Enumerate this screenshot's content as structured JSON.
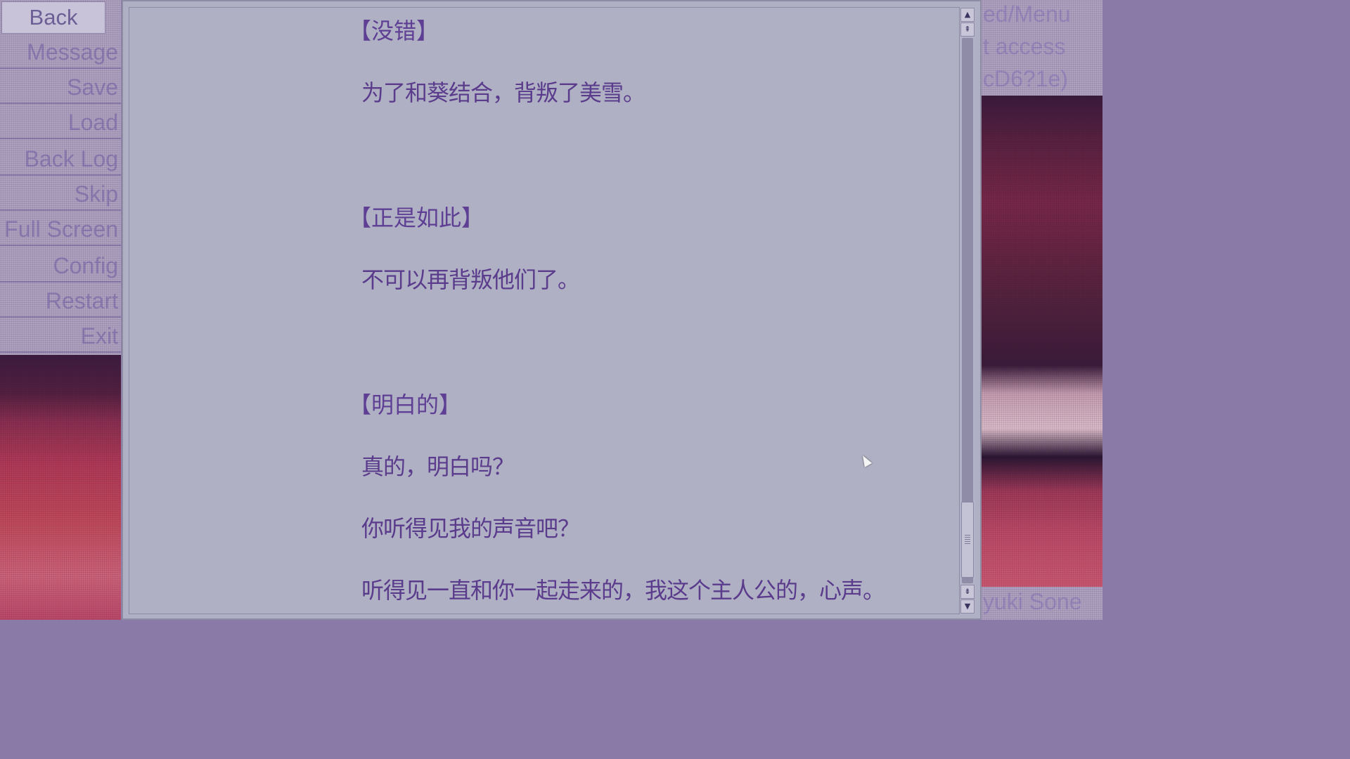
{
  "menu": {
    "back_label": "Back",
    "items": [
      "Message",
      "Save",
      "Load",
      "Back Log",
      "Skip",
      "Full Screen",
      "Config",
      "Restart",
      "Exit"
    ]
  },
  "right_panel": {
    "text_lines": [
      "ed/Menu",
      "t access",
      "cD6?1e)"
    ],
    "bottom_text": "yuki Sone"
  },
  "backlog": {
    "entries": [
      {
        "speaker": "【没错】",
        "lines": [
          "为了和葵结合，背叛了美雪。"
        ]
      },
      {
        "speaker": "【正是如此】",
        "lines": [
          "不可以再背叛他们了。"
        ]
      },
      {
        "speaker": "【明白的】",
        "lines": [
          "真的，明白吗？",
          "你听得见我的声音吧？",
          "听得见一直和你一起走来的，我这个主人公的，心声。"
        ]
      }
    ]
  },
  "scrollbar": {
    "up_icon": "▲",
    "top_icon": "⇞",
    "bottom_icon": "⇟",
    "down_icon": "▼",
    "position": 0.92
  },
  "colors": {
    "dialog_bg": "#b0b0c4",
    "text": "#5a3b8c"
  }
}
